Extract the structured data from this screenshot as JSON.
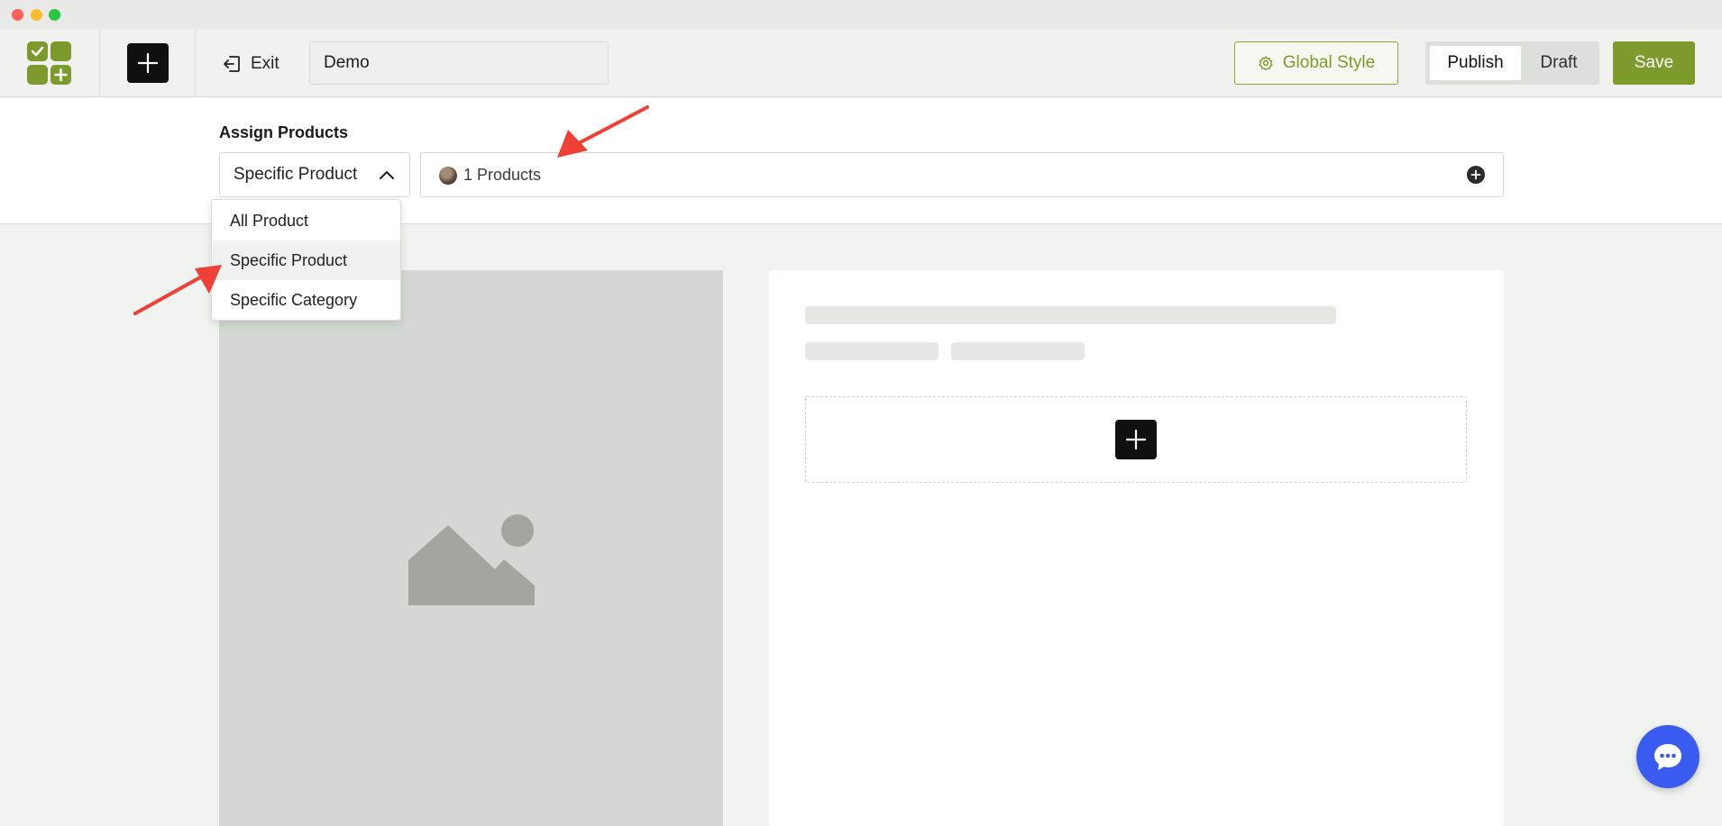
{
  "toolbar": {
    "exit_label": "Exit",
    "page_name": "Demo",
    "global_style_label": "Global Style",
    "publish_label": "Publish",
    "draft_label": "Draft",
    "save_label": "Save"
  },
  "assign": {
    "label": "Assign Products",
    "selected": "Specific Product",
    "products_summary": "1 Products"
  },
  "dropdown": {
    "options": [
      "All Product",
      "Specific Product",
      "Specific Category"
    ],
    "highlighted_index": 1
  },
  "colors": {
    "brand": "#7d9a2c",
    "annotation_arrow": "#ee4036",
    "chat": "#3a5bf0"
  },
  "icons": {
    "logo": "app-logo-icon",
    "add": "plus-icon",
    "exit": "exit-icon",
    "global_style": "gear-icon",
    "chevron": "chevron-up-icon",
    "add_product": "plus-circle-icon",
    "image": "image-placeholder-icon",
    "chat": "chat-bubble-icon"
  }
}
